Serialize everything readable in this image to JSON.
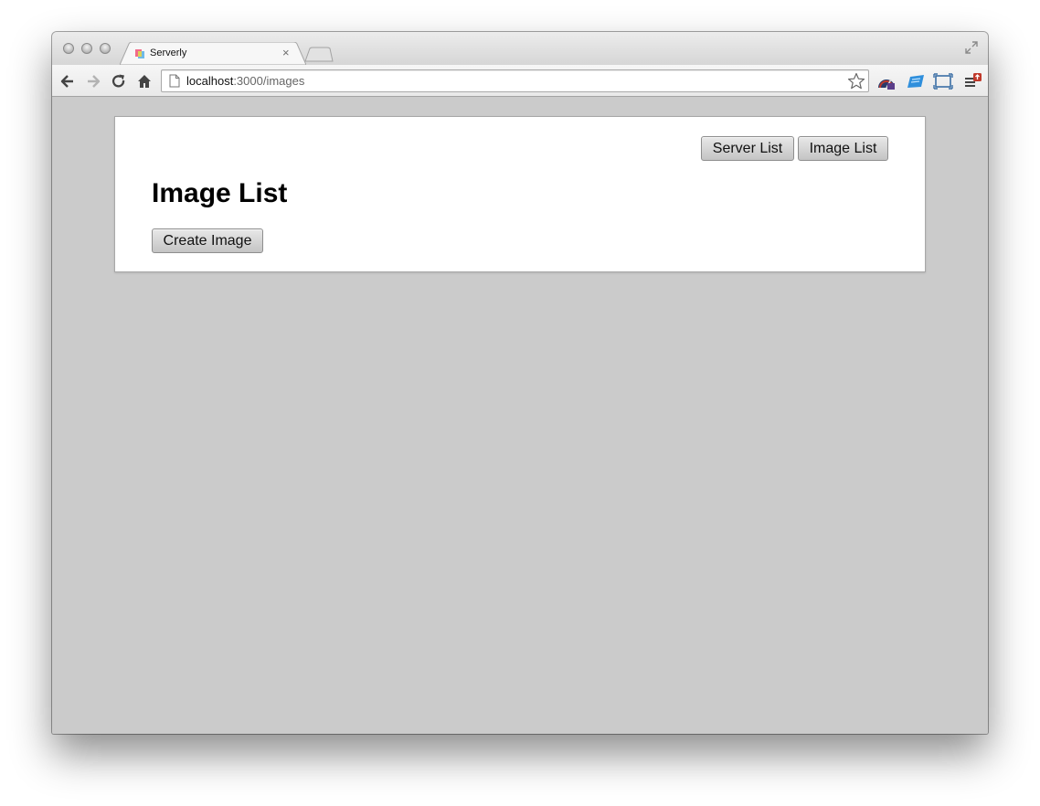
{
  "browser": {
    "tab_title": "Serverly",
    "tab_close": "×",
    "url_host": "localhost",
    "url_rest": ":3000/images"
  },
  "page": {
    "nav": {
      "server_list": "Server List",
      "image_list": "Image List"
    },
    "title": "Image List",
    "create_button": "Create Image"
  },
  "colors": {
    "page_background": "#cbcbcb",
    "card_background": "#ffffff"
  },
  "icons": [
    "back-icon",
    "forward-icon",
    "reload-icon",
    "home-icon",
    "page-icon",
    "bookmark-star-icon",
    "fullscreen-icon"
  ]
}
